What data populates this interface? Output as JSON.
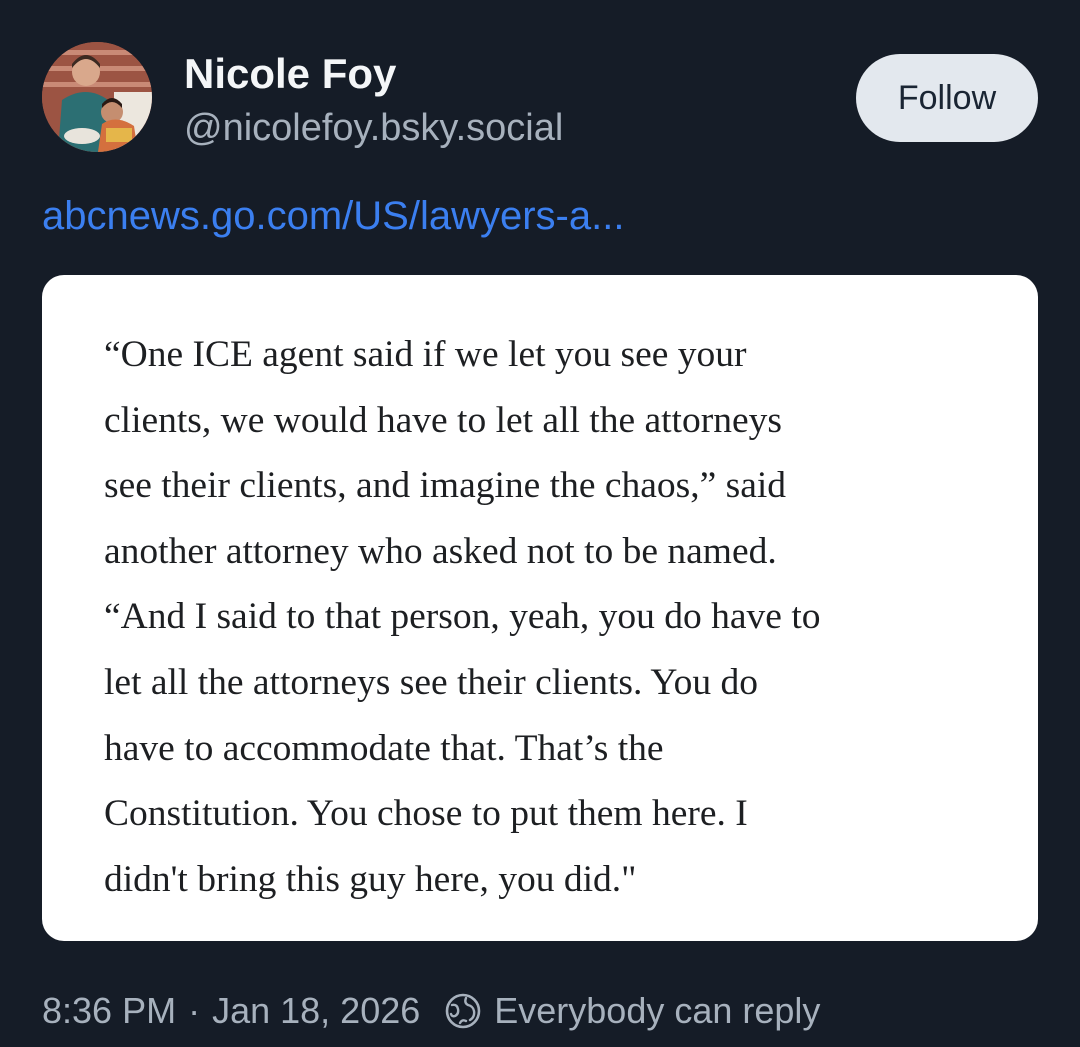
{
  "post": {
    "author": {
      "display_name": "Nicole Foy",
      "handle": "@nicolefoy.bsky.social",
      "avatar_icon": "profile-photo"
    },
    "follow_label": "Follow",
    "link_text": "abcnews.go.com/US/lawyers-a...",
    "quote_lines": [
      "“One ICE agent said if we let you see your",
      "clients, we would have to let all the attorneys",
      "see their clients, and imagine the chaos,” said",
      "another attorney who asked not to be named.",
      "“And I said to that person, yeah, you do have to",
      "let all the attorneys see their clients. You do",
      "have to accommodate that. That’s the",
      "Constitution. You chose to put them here. I",
      "didn't bring this guy here, you did.\""
    ],
    "time": "8:36 PM",
    "separator": "·",
    "date": "Jan 18, 2026",
    "reply_icon": "globe-icon",
    "reply_setting": "Everybody can reply"
  },
  "colors": {
    "background": "#151c27",
    "link": "#3b7ff0",
    "muted_text": "#a7b1bd",
    "follow_button_bg": "#e3e8ee"
  }
}
